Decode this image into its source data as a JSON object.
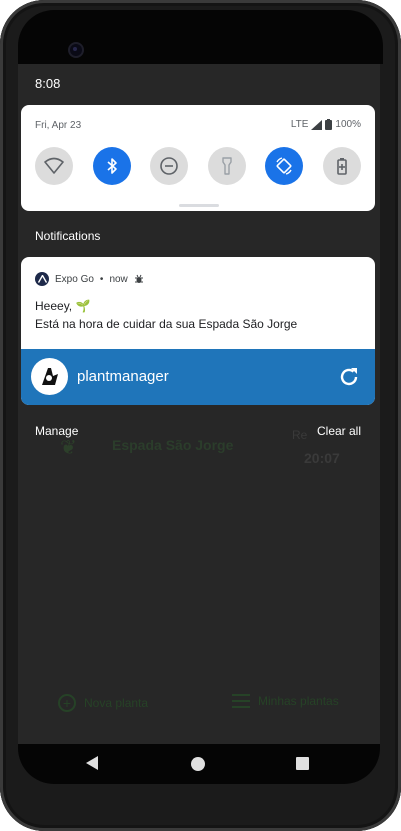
{
  "status_bar": {
    "time": "8:08"
  },
  "quick_settings": {
    "date": "Fri, Apr 23",
    "network": "LTE",
    "battery": "100%",
    "tiles": [
      {
        "name": "wifi",
        "active": false
      },
      {
        "name": "bluetooth",
        "active": true
      },
      {
        "name": "do-not-disturb",
        "active": false
      },
      {
        "name": "flashlight",
        "active": false
      },
      {
        "name": "auto-rotate",
        "active": true
      },
      {
        "name": "battery-saver",
        "active": false
      }
    ]
  },
  "notifications_heading": "Notifications",
  "notification": {
    "app": "Expo Go",
    "when": "now",
    "title": "Heeey, 🌱",
    "body": "Está na hora de cuidar da sua Espada São Jorge",
    "app_bar_name": "plantmanager"
  },
  "footer": {
    "manage": "Manage",
    "clear_all": "Clear all"
  },
  "background_app": {
    "plant_name": "Espada São Jorge",
    "reg_label": "Re",
    "time": "20:07",
    "tab_new": "Nova planta",
    "tab_mine": "Minhas plantas"
  },
  "colors": {
    "accent": "#1a73e8",
    "bar": "#1f75ba",
    "shade": "#272727"
  }
}
